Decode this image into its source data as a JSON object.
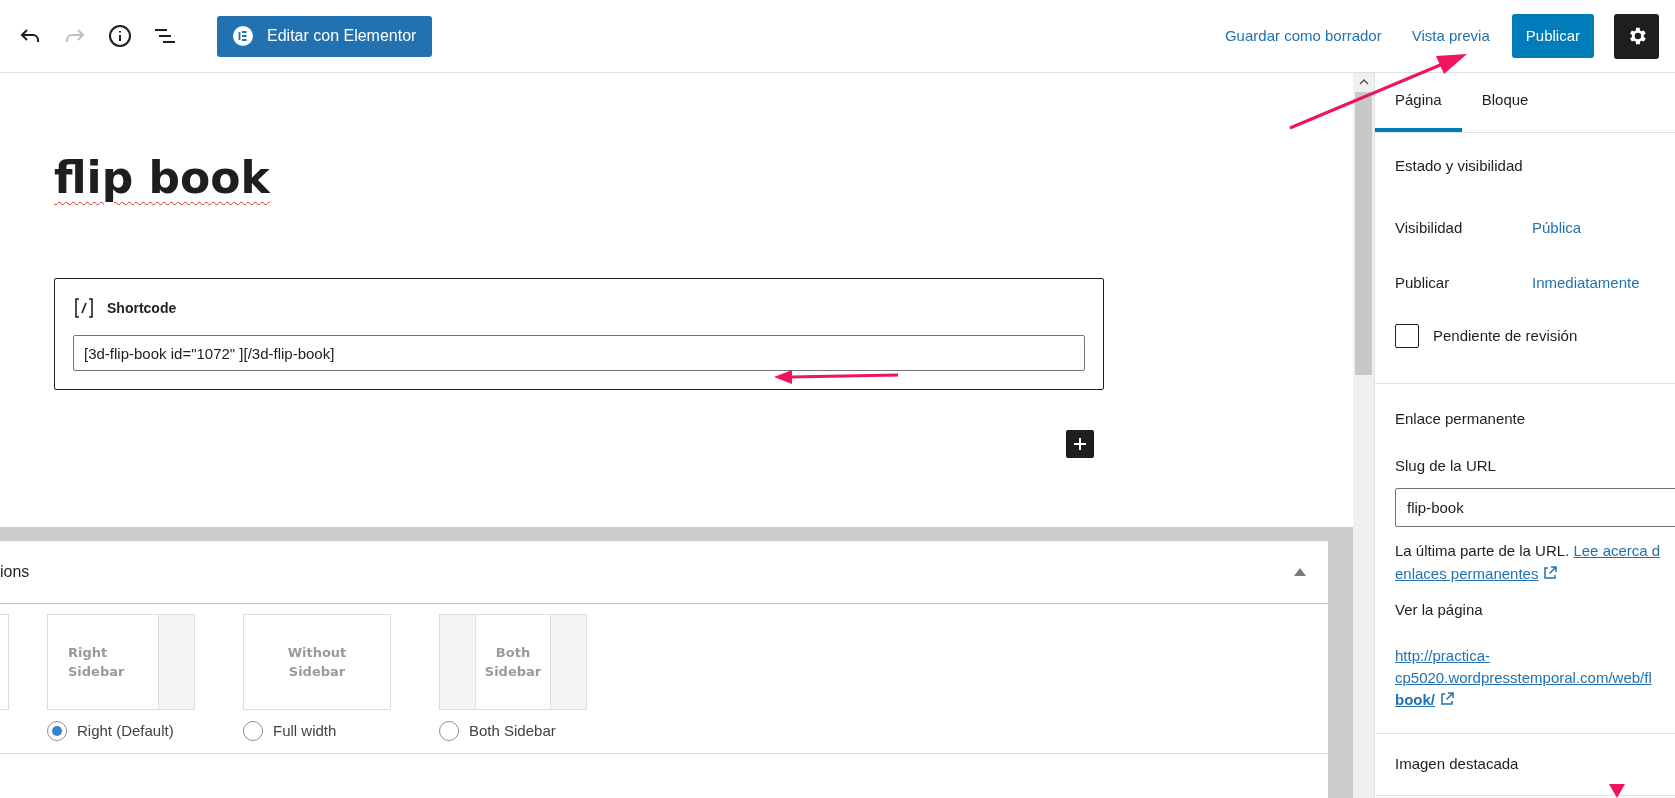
{
  "toolbar": {
    "redo_disabled": true,
    "elementor_button": "Editar con Elementor",
    "save_draft": "Guardar como borrador",
    "preview": "Vista previa",
    "publish": "Publicar"
  },
  "title": "flip book",
  "block": {
    "name": "Shortcode",
    "value": "[3d-flip-book id=\"1072\" ][/3d-flip-book]"
  },
  "layout_panel": {
    "heading": "ions",
    "expanded": true,
    "options": [
      {
        "kind": "right",
        "thumb_label": "Right Sidebar",
        "label": "Right (Default)",
        "selected": true
      },
      {
        "kind": "none",
        "thumb_label": "Without Sidebar",
        "label": "Full width",
        "selected": false
      },
      {
        "kind": "both",
        "thumb_label": "Both Sidebar",
        "label": "Both Sidebar",
        "selected": false
      }
    ]
  },
  "sidebar": {
    "tabs": [
      {
        "label": "Página",
        "selected": true
      },
      {
        "label": "Bloque",
        "selected": false
      }
    ],
    "status": {
      "heading": "Estado y visibilidad",
      "rows": [
        {
          "label": "Visibilidad",
          "value": "Pública"
        },
        {
          "label": "Publicar",
          "value": "Inmediatamente"
        }
      ],
      "pending_review": {
        "label": "Pendiente de revisión",
        "checked": false
      }
    },
    "permalink": {
      "heading": "Enlace permanente",
      "slug_label": "Slug de la URL",
      "slug_value": "flip-book",
      "help": "La última parte de la URL.",
      "help_link": "Lee acerca d",
      "help_link_2": "enlaces permanentes",
      "view_label": "Ver la página",
      "url_lines": [
        "http://practica-",
        "cp5020.wordpresstemporal.com/web/fl",
        "book/"
      ]
    },
    "featured_image": {
      "heading": "Imagen destacada"
    }
  }
}
